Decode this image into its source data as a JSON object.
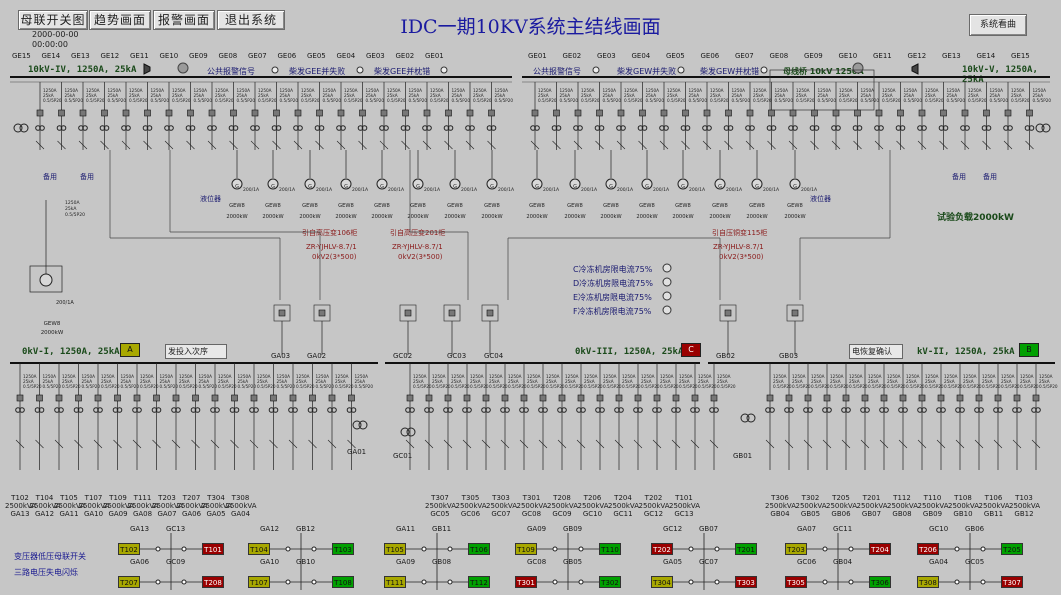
{
  "nav": {
    "buttons": [
      "母联开关图",
      "趋势画面",
      "报警画面",
      "退出系统"
    ]
  },
  "title": "IDC一期10KV系统主结线画面",
  "system_button": "系统看曲",
  "clock": {
    "date": "2000-00-00",
    "time": "00:00:00"
  },
  "top_tags_left": [
    "GE15",
    "GE14",
    "GE13",
    "GE12",
    "GE11",
    "GE10",
    "GE09",
    "GE08",
    "GE07",
    "GE06",
    "GE05",
    "GE04",
    "GE03",
    "GE02",
    "GE01"
  ],
  "top_tags_right": [
    "GE01",
    "GE02",
    "GE03",
    "GE04",
    "GE05",
    "GE06",
    "GE07",
    "GE08",
    "GE09",
    "GE10",
    "GE11",
    "GE12",
    "GE13",
    "GE14",
    "GE15"
  ],
  "bus_top": {
    "left_label": "10kV-IV, 1250A, 25kA",
    "right_label": "10kV-V, 1250A, 25kA",
    "mother_label": "母线桥 10kV 1250A"
  },
  "signals_left": [
    "公共报警信号",
    "柴发GEE并失败",
    "柴发GEE并枕错"
  ],
  "signals_right": [
    "公共报警信号",
    "柴发GEW并失败",
    "柴发GEW并枕错"
  ],
  "feeder_spec": [
    "1250A",
    "25kA",
    "0.5/5P20"
  ],
  "genset": {
    "current": "200/1A",
    "name": "GEW8",
    "power": "2000kW"
  },
  "misc_top": {
    "spare_l1": "备用",
    "spare_l2": "备用",
    "spare_r1": "备用",
    "spare_r2": "备用",
    "lvl_left": "液位器",
    "lvl_right": "液位器",
    "test_load": "试验负载2000kW"
  },
  "cable_notes": [
    "引自高压变106柜",
    "引自高压变201柜",
    "引自压铜变115柜"
  ],
  "cable_types": [
    "ZR-YJHLV-8.7/1",
    "ZR-YJHLV-8.7/1",
    "ZR-YJHLV-8.7/1"
  ],
  "cable_size": "0kV2(3*500)",
  "chiller_lamps": [
    "C冷冻机房限电流75%",
    "D冷冻机房限电流75%",
    "E冷冻机房限电流75%",
    "F冷冻机房限电流75%"
  ],
  "bus_mid": {
    "left_label": "0kV-I, 1250A, 25kA",
    "center_label": "0kV-III, 1250A, 25kA",
    "right_label": "kV-II, 1250A, 25kA",
    "left_badge": "A",
    "center_badge": "C",
    "right_badge": "B",
    "left_field": "发投入次序",
    "right_field": "电恢复确认",
    "colors": {
      "A": "#a8a800",
      "C": "#9a0000",
      "B": "#00a000"
    }
  },
  "mid_tags": [
    "GA03",
    "GA02",
    "GC02",
    "GC03",
    "GC04",
    "GB02",
    "GB03"
  ],
  "lower_tags": [
    "GA01",
    "GC01",
    "GB01"
  ],
  "bottom_transformers_left": [
    {
      "t": "T102",
      "kva": "2500kVA",
      "g": "GA13"
    },
    {
      "t": "T104",
      "kva": "2500kVA",
      "g": "GA12"
    },
    {
      "t": "T105",
      "kva": "2500kVA",
      "g": "GA11"
    },
    {
      "t": "T107",
      "kva": "2500kVA",
      "g": "GA10"
    },
    {
      "t": "T109",
      "kva": "2500kVA",
      "g": "GA09"
    },
    {
      "t": "T111",
      "kva": "2500kVA",
      "g": "GA08"
    },
    {
      "t": "T203",
      "kva": "2500kVA",
      "g": "GA07"
    },
    {
      "t": "T207",
      "kva": "2500kVA",
      "g": "GA06"
    },
    {
      "t": "T304",
      "kva": "2500kVA",
      "g": "GA05"
    },
    {
      "t": "T308",
      "kva": "2500kVA",
      "g": "GA04"
    }
  ],
  "bottom_transformers_center": [
    {
      "t": "T307",
      "kva": "2500kVA",
      "g": "GC05"
    },
    {
      "t": "T305",
      "kva": "2500kVA",
      "g": "GC06"
    },
    {
      "t": "T303",
      "kva": "2500kVA",
      "g": "GC07"
    },
    {
      "t": "T301",
      "kva": "2500kVA",
      "g": "GC08"
    },
    {
      "t": "T208",
      "kva": "2500kVA",
      "g": "GC09"
    },
    {
      "t": "T206",
      "kva": "2500kVA",
      "g": "GC10"
    },
    {
      "t": "T204",
      "kva": "2500kVA",
      "g": "GC11"
    },
    {
      "t": "T202",
      "kva": "2500kVA",
      "g": "GC12"
    },
    {
      "t": "T101",
      "kva": "2500kVA",
      "g": "GC13"
    }
  ],
  "bottom_transformers_right": [
    {
      "t": "T306",
      "kva": "2500kVA",
      "g": "GB04"
    },
    {
      "t": "T302",
      "kva": "2500kVA",
      "g": "GB05"
    },
    {
      "t": "T205",
      "kva": "2500kVA",
      "g": "GB06"
    },
    {
      "t": "T201",
      "kva": "2500kVA",
      "g": "GB07"
    },
    {
      "t": "T112",
      "kva": "2500kVA",
      "g": "GB08"
    },
    {
      "t": "T110",
      "kva": "2500kVA",
      "g": "GB09"
    },
    {
      "t": "T108",
      "kva": "2500kVA",
      "g": "GB10"
    },
    {
      "t": "T106",
      "kva": "2500kVA",
      "g": "GB11"
    },
    {
      "t": "T103",
      "kva": "2500kVA",
      "g": "GB12"
    }
  ],
  "legend": {
    "line1": "变压器低压母联开关",
    "line2": "三路电压失电闪烁"
  },
  "tie_groups": [
    {
      "tl": "GA13",
      "tr": "GC13",
      "bl": "GA06",
      "br": "GC09",
      "t1": "T102",
      "t1c": "#a8a800",
      "t2": "T101",
      "t2c": "#9a0000",
      "t3": "T207",
      "t3c": "#a8a800",
      "t4": "T208",
      "t4c": "#9a0000"
    },
    {
      "tl": "GA12",
      "tr": "GB12",
      "bl": "GA10",
      "br": "GB10",
      "t1": "T104",
      "t1c": "#a8a800",
      "t2": "T103",
      "t2c": "#00a000",
      "t3": "T107",
      "t3c": "#a8a800",
      "t4": "T108",
      "t4c": "#00a000"
    },
    {
      "tl": "GA11",
      "tr": "GB11",
      "bl": "GA09",
      "br": "GB08",
      "t1": "T105",
      "t1c": "#a8a800",
      "t2": "T106",
      "t2c": "#00a000",
      "t3": "T111",
      "t3c": "#a8a800",
      "t4": "T112",
      "t4c": "#00a000"
    },
    {
      "tl": "GA09",
      "tr": "GB09",
      "bl": "GC08",
      "br": "GB05",
      "t1": "T109",
      "t1c": "#a8a800",
      "t2": "T110",
      "t2c": "#00a000",
      "t3": "T301",
      "t3c": "#9a0000",
      "t4": "T302",
      "t4c": "#00a000"
    },
    {
      "tl": "GC12",
      "tr": "GB07",
      "bl": "GA05",
      "br": "GC07",
      "t1": "T202",
      "t1c": "#9a0000",
      "t2": "T201",
      "t2c": "#00a000",
      "t3": "T304",
      "t3c": "#a8a800",
      "t4": "T303",
      "t4c": "#9a0000"
    },
    {
      "tl": "GA07",
      "tr": "GC11",
      "bl": "GC06",
      "br": "GB04",
      "t1": "T203",
      "t1c": "#a8a800",
      "t2": "T204",
      "t2c": "#9a0000",
      "t3": "T305",
      "t3c": "#9a0000",
      "t4": "T306",
      "t4c": "#00a000"
    },
    {
      "tl": "GC10",
      "tr": "GB06",
      "bl": "GA04",
      "br": "GC05",
      "t1": "T206",
      "t1c": "#9a0000",
      "t2": "T205",
      "t2c": "#00a000",
      "t3": "T308",
      "t3c": "#a8a800",
      "t4": "T307",
      "t4c": "#9a0000"
    }
  ]
}
